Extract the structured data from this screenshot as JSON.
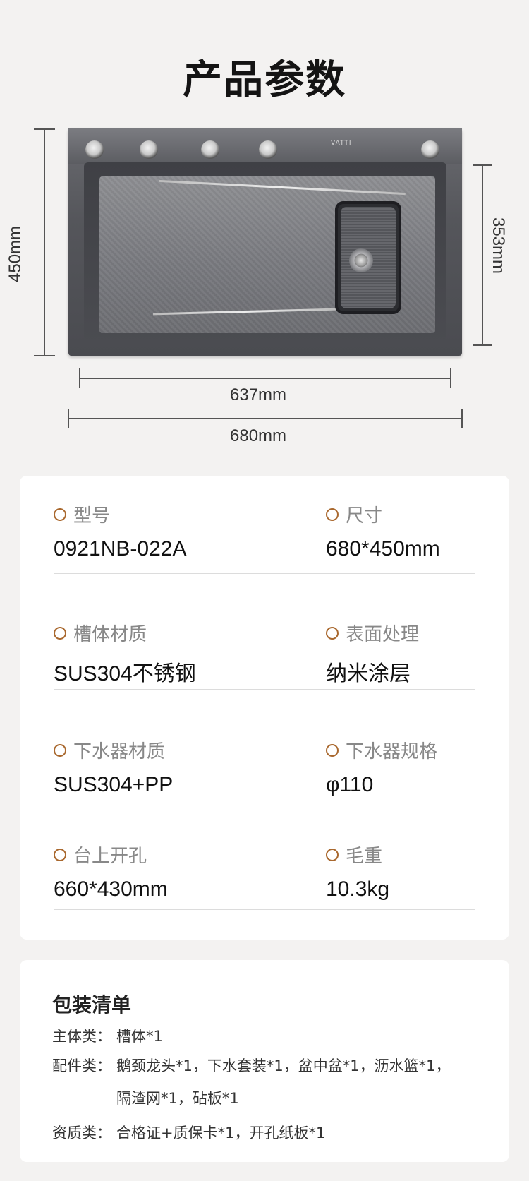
{
  "title": "产品参数",
  "sink_image": {
    "brand_text": "VATTI",
    "dimensions": {
      "height_outer": "450mm",
      "height_inner": "353mm",
      "width_inner": "637mm",
      "width_outer": "680mm"
    }
  },
  "specs": [
    {
      "label": "型号",
      "value": "0921NB-022A"
    },
    {
      "label": "尺寸",
      "value": "680*450mm"
    },
    {
      "label": "槽体材质",
      "value": "SUS304不锈钢"
    },
    {
      "label": "表面处理",
      "value": "纳米涂层"
    },
    {
      "label": "下水器材质",
      "value": "SUS304+PP"
    },
    {
      "label": "下水器规格",
      "value": "φ110"
    },
    {
      "label": "台上开孔",
      "value": "660*430mm"
    },
    {
      "label": "毛重",
      "value": "10.3kg"
    }
  ],
  "package": {
    "title": "包装清单",
    "rows": [
      {
        "key": "主体类：",
        "value": "槽体*1"
      },
      {
        "key": "配件类：",
        "value": "鹅颈龙头*1，下水套装*1，盆中盆*1，沥水篮*1，",
        "value2": "隔渣网*1，砧板*1"
      },
      {
        "key": "资质类：",
        "value": "合格证+质保卡*1，开孔纸板*1"
      }
    ]
  },
  "colors": {
    "accent": "#a9682e",
    "background": "#f3f2f1",
    "card": "#ffffff"
  },
  "icons": {
    "spec_bullet": "circle-outline-icon"
  }
}
